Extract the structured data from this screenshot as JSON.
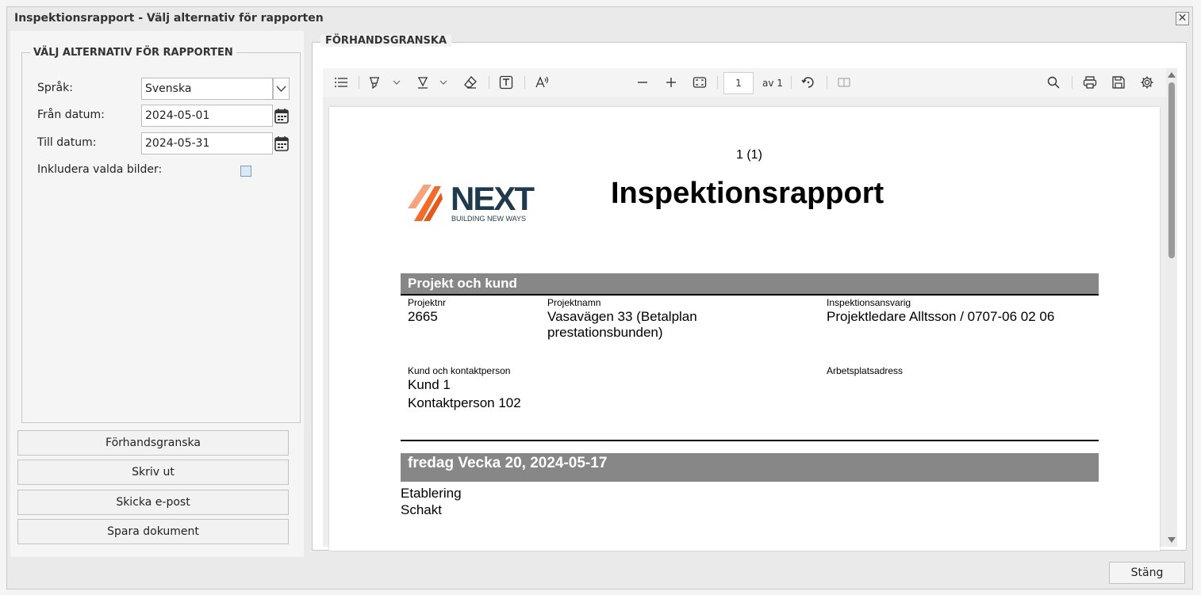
{
  "dialog": {
    "title": "Inspektionsrapport - Välj alternativ för rapporten",
    "close_label": "✕"
  },
  "options": {
    "legend": "VÄLJ ALTERNATIV FÖR RAPPORTEN",
    "language_label": "Språk:",
    "language_value": "Svenska",
    "from_label": "Från datum:",
    "from_value": "2024-05-01",
    "to_label": "Till datum:",
    "to_value": "2024-05-31",
    "include_images_label": "Inkludera valda bilder:",
    "include_images_checked": false
  },
  "actions": {
    "preview": "Förhandsgranska",
    "print": "Skriv ut",
    "email": "Skicka e-post",
    "save": "Spara dokument"
  },
  "preview": {
    "legend": "FÖRHANDSGRANSKA",
    "toolbar": {
      "page_current": "1",
      "page_total": "av 1"
    }
  },
  "document": {
    "page_number": "1 (1)",
    "title": "Inspektionsrapport",
    "logo": {
      "name": "NEXT",
      "tagline": "BUILDING NEW WAYS",
      "accent_color": "#f26b2a",
      "text_color": "#1f3a4d"
    },
    "section_project": "Projekt och kund",
    "projektnr_label": "Projektnr",
    "projektnr_value": "2665",
    "projektnamn_label": "Projektnamn",
    "projektnamn_line1": "Vasavägen 33 (Betalplan",
    "projektnamn_line2": "prestationsbunden)",
    "ansvarig_label": "Inspektionsansvarig",
    "ansvarig_value": "Projektledare Alltsson / 0707-06 02 06",
    "kund_label": "Kund och kontaktperson",
    "kund_value": "Kund 1",
    "kontakt_value": "Kontaktperson 102",
    "adress_label": "Arbetsplatsadress",
    "section_day": "fredag Vecka 20, 2024-05-17",
    "items": [
      "Etablering",
      "Schakt"
    ]
  },
  "footer": {
    "close_button": "Stäng"
  }
}
